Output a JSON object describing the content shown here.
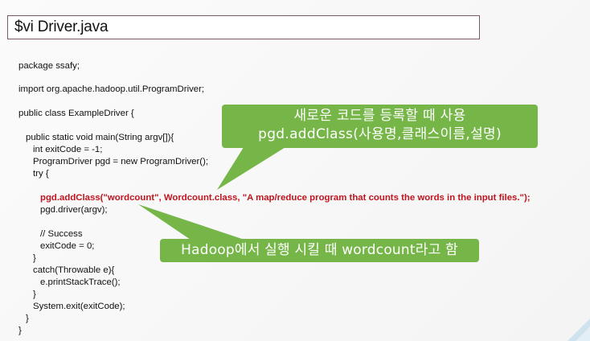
{
  "title": "$vi Driver.java",
  "code_lines": [
    "package ssafy;",
    "import org.apache.hadoop.util.ProgramDriver;",
    "public class ExampleDriver {",
    "public static void main(String argv[]){",
    "int exitCode = -1;",
    "ProgramDriver pgd = new ProgramDriver();",
    "try {",
    "pgd.addClass(\"wordcount\", Wordcount.class, \"A map/reduce program that counts the words in the input files.\");",
    "pgd.driver(argv);",
    "// Success",
    "exitCode = 0;",
    "}",
    "catch(Throwable e){",
    "e.printStackTrace();",
    "}",
    "System.exit(exitCode);",
    "}",
    "}"
  ],
  "callouts": {
    "first": {
      "line1": "새로운 코드를 등록할 때 사용",
      "line2": "pgd.addClass(사용명,클래스이름,설명)"
    },
    "second": {
      "line1": "Hadoop에서 실행 시킬 때 wordcount라고 함"
    }
  },
  "colors": {
    "callout_green": "#76b648",
    "highlight_red": "#c0141e",
    "title_border": "#7a5a66"
  }
}
